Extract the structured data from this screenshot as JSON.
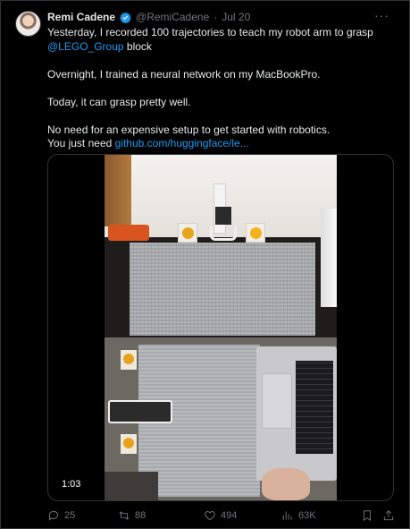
{
  "tweet": {
    "author_name": "Remi Cadene",
    "author_handle": "@RemiCadene",
    "separator": "·",
    "date": "Jul 20",
    "more_label": "···",
    "text": {
      "line1_pre": "Yesterday, I recorded 100 trajectories to teach my robot arm to grasp",
      "mention": "@LEGO_Group",
      "line1_post": " block",
      "para2": "Overnight, I trained a neural network on my MacBookPro.",
      "para3": "Today,  it can grasp pretty well.",
      "para4_line1": "No need for an expensive setup to get started with robotics.",
      "para4_line2_pre": "You just need ",
      "link": "github.com/huggingface/le..."
    },
    "video": {
      "duration": "1:03"
    },
    "stats": {
      "replies": "25",
      "retweets": "88",
      "likes": "494",
      "views": "63K"
    }
  },
  "colors": {
    "background": "#000000",
    "text": "#e7e9ea",
    "muted": "#71767b",
    "link": "#1d9bf0",
    "verified": "#1d9bf0"
  }
}
